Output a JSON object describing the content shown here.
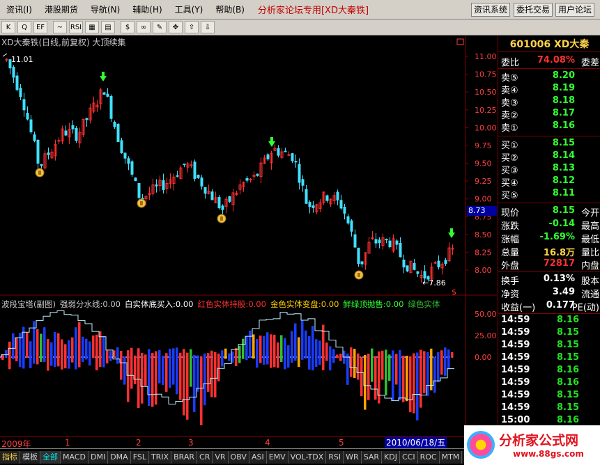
{
  "menu": {
    "items": [
      "资讯(I)",
      "港股期货",
      "导航(N)",
      "辅助(H)",
      "工具(Y)",
      "帮助(B)"
    ],
    "brand": "分析家论坛专用[XD大秦铁]",
    "right_buttons": [
      "资讯系统",
      "委托交易",
      "用户论坛"
    ]
  },
  "toolbar": {
    "icons": [
      {
        "name": "kline-icon",
        "glyph": "K"
      },
      {
        "name": "zoom-icon",
        "glyph": "Q"
      },
      {
        "name": "f10-icon",
        "glyph": "EF"
      },
      {
        "name": "trend-icon",
        "glyph": "~"
      },
      {
        "name": "rsi-icon",
        "glyph": "RSI"
      },
      {
        "name": "grid-icon",
        "glyph": "▦"
      },
      {
        "name": "indicator-icon",
        "glyph": "▤"
      },
      {
        "name": "money-icon",
        "glyph": "$"
      },
      {
        "name": "link-icon",
        "glyph": "∞"
      },
      {
        "name": "draw-icon",
        "glyph": "✎"
      },
      {
        "name": "move-icon",
        "glyph": "✥"
      },
      {
        "name": "arrow-up-icon",
        "glyph": "⇧"
      },
      {
        "name": "arrow-down-icon",
        "glyph": "⇩"
      }
    ]
  },
  "chart": {
    "title": "XD大秦铁(日线,前复权) 大顶续集",
    "high_label": "11.01",
    "low_label": "←7.86",
    "current_price_box": "8.73",
    "price_ticks": [
      "11.00",
      "10.75",
      "10.50",
      "10.25",
      "10.00",
      "9.75",
      "9.50",
      "9.25",
      "9.00",
      "8.75",
      "8.50",
      "8.25",
      "8.00"
    ],
    "indicator_ticks": [
      "50.00",
      "25.00",
      "0.00"
    ],
    "indicator_title": [
      {
        "text": "波段宝塔(副图)",
        "color": "#c8c8c8"
      },
      {
        "text": "强弱分水线:0.00",
        "color": "#c8c8c8"
      },
      {
        "text": "白实体底买入:0.00",
        "color": "#ffffff"
      },
      {
        "text": "红色实体持股:0.00",
        "color": "#ff3030"
      },
      {
        "text": "金色实体变盘:0.00",
        "color": "#ffcc00"
      },
      {
        "text": "鲜绿顶抛售:0.00",
        "color": "#30ff30"
      },
      {
        "text": "绿色实体",
        "color": "#30c030"
      }
    ],
    "year_label": "2009年",
    "month_labels": [
      "1",
      "2",
      "3",
      "4",
      "5"
    ],
    "cursor_date": "2010/06/18/五",
    "colors": {
      "up": "#ff3030",
      "down": "#40e0ff",
      "blue": "#1a3cff",
      "gold": "#ffa500",
      "green": "#30c030",
      "grid": "#800000"
    }
  },
  "panel": {
    "header": "601006 XD大秦",
    "ratio": {
      "label": "委比",
      "value": "74.08%",
      "right": "委差"
    },
    "sells": [
      {
        "label": "卖⑤",
        "price": "8.20"
      },
      {
        "label": "卖④",
        "price": "8.19"
      },
      {
        "label": "卖③",
        "price": "8.18"
      },
      {
        "label": "卖②",
        "price": "8.17"
      },
      {
        "label": "卖①",
        "price": "8.16"
      }
    ],
    "buys": [
      {
        "label": "买①",
        "price": "8.15"
      },
      {
        "label": "买②",
        "price": "8.14"
      },
      {
        "label": "买③",
        "price": "8.13"
      },
      {
        "label": "买④",
        "price": "8.12"
      },
      {
        "label": "买⑤",
        "price": "8.11"
      }
    ],
    "quote": [
      {
        "label": "现价",
        "value": "8.15",
        "right": "今开",
        "color": "#30ff30"
      },
      {
        "label": "涨跌",
        "value": "-0.14",
        "right": "最高",
        "color": "#30ff30"
      },
      {
        "label": "涨幅",
        "value": "-1.69%",
        "right": "最低",
        "color": "#30ff30"
      },
      {
        "label": "总量",
        "value": "16.8万",
        "right": "量比",
        "color": "#ffd24a"
      },
      {
        "label": "外盘",
        "value": "72817",
        "right": "内盘",
        "color": "#ff3030"
      }
    ],
    "stats": [
      {
        "label": "换手",
        "value": "0.13%",
        "right": "股本",
        "color": "#ffffff"
      },
      {
        "label": "净资",
        "value": "3.49",
        "right": "流通",
        "color": "#ffffff"
      },
      {
        "label": "收益(一)",
        "value": "0.177",
        "right": "PE(动)",
        "color": "#ffffff"
      }
    ],
    "trades": [
      {
        "time": "14:59",
        "price": "8.16"
      },
      {
        "time": "14:59",
        "price": "8.15"
      },
      {
        "time": "14:59",
        "price": "8.15"
      },
      {
        "time": "14:59",
        "price": "8.15"
      },
      {
        "time": "14:59",
        "price": "8.16"
      },
      {
        "time": "14:59",
        "price": "8.16"
      },
      {
        "time": "14:59",
        "price": "8.15"
      },
      {
        "time": "14:59",
        "price": "8.15"
      },
      {
        "time": "15:00",
        "price": "8.16"
      }
    ]
  },
  "tabs": [
    "指标",
    "模板",
    "全部",
    "MACD",
    "DMI",
    "DMA",
    "FSL",
    "TRIX",
    "BRAR",
    "CR",
    "VR",
    "OBV",
    "ASI",
    "EMV",
    "VOL-TDX",
    "RSI",
    "WR",
    "SAR",
    "KDJ",
    "CCI",
    "ROC",
    "MTM",
    "BOLL",
    "PSY"
  ],
  "logo": {
    "title": "分析家公式网",
    "url": "www.88gs.com"
  }
}
